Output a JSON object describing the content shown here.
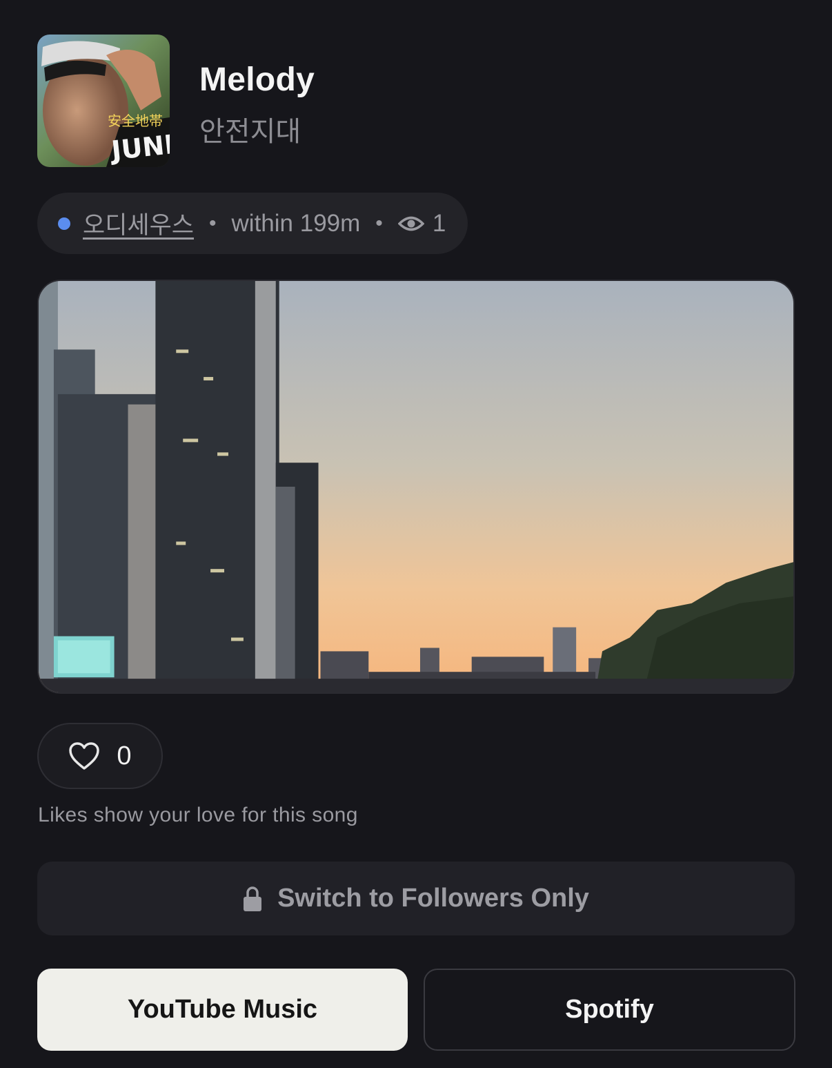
{
  "song": {
    "title": "Melody",
    "artist": "안전지대",
    "album_art_text": [
      "安全地帯",
      "JUNK"
    ]
  },
  "meta": {
    "place": "오디세우스",
    "separator": "•",
    "distance": "within 199m",
    "views": "1",
    "status_color": "#5b8def"
  },
  "photo": {
    "subject": "city-skyline-sunset"
  },
  "likes": {
    "count": "0",
    "hint": "Likes show your love for this song"
  },
  "followers_button": {
    "label": "Switch to Followers Only",
    "icon": "lock-icon"
  },
  "links": {
    "youtube_music": "YouTube Music",
    "spotify": "Spotify"
  },
  "colors": {
    "background": "#16161b",
    "pill": "#232328",
    "primary_button": "#efefea"
  }
}
